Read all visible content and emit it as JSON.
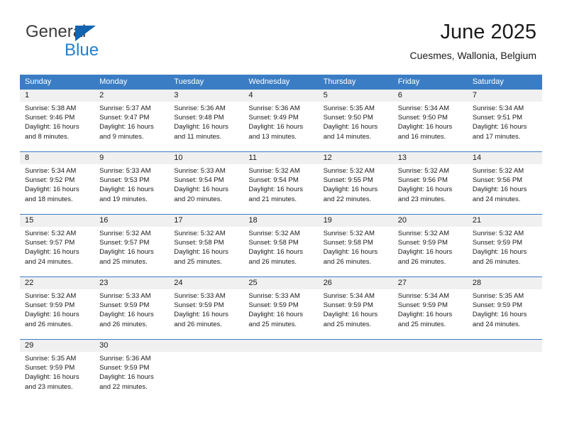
{
  "logo": {
    "line1": "General",
    "line2": "Blue",
    "triangle_color": "#1263b0",
    "line1_color": "#3c3c3c",
    "line2_color": "#1f7fd0"
  },
  "header": {
    "title": "June 2025",
    "subtitle": "Cuesmes, Wallonia, Belgium"
  },
  "theme": {
    "header_bar": "#3b7dc4",
    "daynum_band": "#f0f0f0",
    "row_divider": "#3b7dc4",
    "text": "#1a1a1a"
  },
  "weekdays": [
    "Sunday",
    "Monday",
    "Tuesday",
    "Wednesday",
    "Thursday",
    "Friday",
    "Saturday"
  ],
  "weeks": [
    {
      "days": [
        {
          "num": "1",
          "sunrise": "Sunrise: 5:38 AM",
          "sunset": "Sunset: 9:46 PM",
          "daylight": "Daylight: 16 hours and 8 minutes."
        },
        {
          "num": "2",
          "sunrise": "Sunrise: 5:37 AM",
          "sunset": "Sunset: 9:47 PM",
          "daylight": "Daylight: 16 hours and 9 minutes."
        },
        {
          "num": "3",
          "sunrise": "Sunrise: 5:36 AM",
          "sunset": "Sunset: 9:48 PM",
          "daylight": "Daylight: 16 hours and 11 minutes."
        },
        {
          "num": "4",
          "sunrise": "Sunrise: 5:36 AM",
          "sunset": "Sunset: 9:49 PM",
          "daylight": "Daylight: 16 hours and 13 minutes."
        },
        {
          "num": "5",
          "sunrise": "Sunrise: 5:35 AM",
          "sunset": "Sunset: 9:50 PM",
          "daylight": "Daylight: 16 hours and 14 minutes."
        },
        {
          "num": "6",
          "sunrise": "Sunrise: 5:34 AM",
          "sunset": "Sunset: 9:50 PM",
          "daylight": "Daylight: 16 hours and 16 minutes."
        },
        {
          "num": "7",
          "sunrise": "Sunrise: 5:34 AM",
          "sunset": "Sunset: 9:51 PM",
          "daylight": "Daylight: 16 hours and 17 minutes."
        }
      ]
    },
    {
      "days": [
        {
          "num": "8",
          "sunrise": "Sunrise: 5:34 AM",
          "sunset": "Sunset: 9:52 PM",
          "daylight": "Daylight: 16 hours and 18 minutes."
        },
        {
          "num": "9",
          "sunrise": "Sunrise: 5:33 AM",
          "sunset": "Sunset: 9:53 PM",
          "daylight": "Daylight: 16 hours and 19 minutes."
        },
        {
          "num": "10",
          "sunrise": "Sunrise: 5:33 AM",
          "sunset": "Sunset: 9:54 PM",
          "daylight": "Daylight: 16 hours and 20 minutes."
        },
        {
          "num": "11",
          "sunrise": "Sunrise: 5:32 AM",
          "sunset": "Sunset: 9:54 PM",
          "daylight": "Daylight: 16 hours and 21 minutes."
        },
        {
          "num": "12",
          "sunrise": "Sunrise: 5:32 AM",
          "sunset": "Sunset: 9:55 PM",
          "daylight": "Daylight: 16 hours and 22 minutes."
        },
        {
          "num": "13",
          "sunrise": "Sunrise: 5:32 AM",
          "sunset": "Sunset: 9:56 PM",
          "daylight": "Daylight: 16 hours and 23 minutes."
        },
        {
          "num": "14",
          "sunrise": "Sunrise: 5:32 AM",
          "sunset": "Sunset: 9:56 PM",
          "daylight": "Daylight: 16 hours and 24 minutes."
        }
      ]
    },
    {
      "days": [
        {
          "num": "15",
          "sunrise": "Sunrise: 5:32 AM",
          "sunset": "Sunset: 9:57 PM",
          "daylight": "Daylight: 16 hours and 24 minutes."
        },
        {
          "num": "16",
          "sunrise": "Sunrise: 5:32 AM",
          "sunset": "Sunset: 9:57 PM",
          "daylight": "Daylight: 16 hours and 25 minutes."
        },
        {
          "num": "17",
          "sunrise": "Sunrise: 5:32 AM",
          "sunset": "Sunset: 9:58 PM",
          "daylight": "Daylight: 16 hours and 25 minutes."
        },
        {
          "num": "18",
          "sunrise": "Sunrise: 5:32 AM",
          "sunset": "Sunset: 9:58 PM",
          "daylight": "Daylight: 16 hours and 26 minutes."
        },
        {
          "num": "19",
          "sunrise": "Sunrise: 5:32 AM",
          "sunset": "Sunset: 9:58 PM",
          "daylight": "Daylight: 16 hours and 26 minutes."
        },
        {
          "num": "20",
          "sunrise": "Sunrise: 5:32 AM",
          "sunset": "Sunset: 9:59 PM",
          "daylight": "Daylight: 16 hours and 26 minutes."
        },
        {
          "num": "21",
          "sunrise": "Sunrise: 5:32 AM",
          "sunset": "Sunset: 9:59 PM",
          "daylight": "Daylight: 16 hours and 26 minutes."
        }
      ]
    },
    {
      "days": [
        {
          "num": "22",
          "sunrise": "Sunrise: 5:32 AM",
          "sunset": "Sunset: 9:59 PM",
          "daylight": "Daylight: 16 hours and 26 minutes."
        },
        {
          "num": "23",
          "sunrise": "Sunrise: 5:33 AM",
          "sunset": "Sunset: 9:59 PM",
          "daylight": "Daylight: 16 hours and 26 minutes."
        },
        {
          "num": "24",
          "sunrise": "Sunrise: 5:33 AM",
          "sunset": "Sunset: 9:59 PM",
          "daylight": "Daylight: 16 hours and 26 minutes."
        },
        {
          "num": "25",
          "sunrise": "Sunrise: 5:33 AM",
          "sunset": "Sunset: 9:59 PM",
          "daylight": "Daylight: 16 hours and 25 minutes."
        },
        {
          "num": "26",
          "sunrise": "Sunrise: 5:34 AM",
          "sunset": "Sunset: 9:59 PM",
          "daylight": "Daylight: 16 hours and 25 minutes."
        },
        {
          "num": "27",
          "sunrise": "Sunrise: 5:34 AM",
          "sunset": "Sunset: 9:59 PM",
          "daylight": "Daylight: 16 hours and 25 minutes."
        },
        {
          "num": "28",
          "sunrise": "Sunrise: 5:35 AM",
          "sunset": "Sunset: 9:59 PM",
          "daylight": "Daylight: 16 hours and 24 minutes."
        }
      ]
    },
    {
      "days": [
        {
          "num": "29",
          "sunrise": "Sunrise: 5:35 AM",
          "sunset": "Sunset: 9:59 PM",
          "daylight": "Daylight: 16 hours and 23 minutes."
        },
        {
          "num": "30",
          "sunrise": "Sunrise: 5:36 AM",
          "sunset": "Sunset: 9:59 PM",
          "daylight": "Daylight: 16 hours and 22 minutes."
        },
        {
          "num": "",
          "sunrise": "",
          "sunset": "",
          "daylight": ""
        },
        {
          "num": "",
          "sunrise": "",
          "sunset": "",
          "daylight": ""
        },
        {
          "num": "",
          "sunrise": "",
          "sunset": "",
          "daylight": ""
        },
        {
          "num": "",
          "sunrise": "",
          "sunset": "",
          "daylight": ""
        },
        {
          "num": "",
          "sunrise": "",
          "sunset": "",
          "daylight": ""
        }
      ]
    }
  ]
}
